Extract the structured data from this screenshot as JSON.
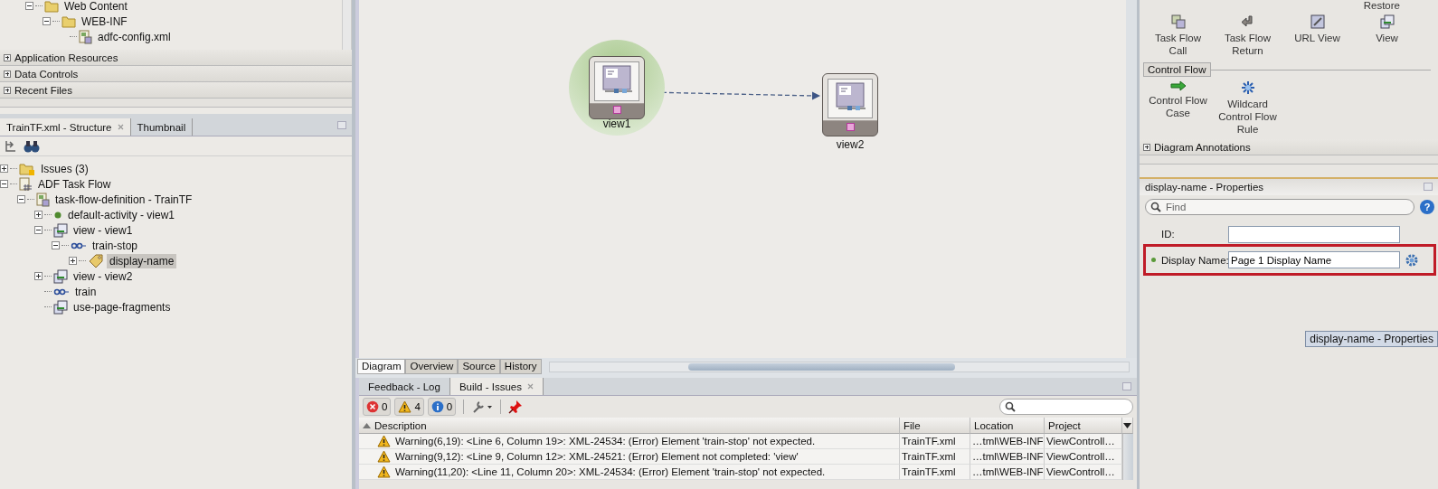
{
  "navigator": {
    "tree": [
      {
        "label": "Web Content",
        "kind": "folder",
        "expanded": true,
        "selected": false,
        "children": [
          {
            "label": "WEB-INF",
            "kind": "folder",
            "expanded": true,
            "selected": false,
            "children": [
              {
                "label": "adfc-config.xml",
                "kind": "file",
                "selected": false
              }
            ]
          }
        ]
      }
    ],
    "accordions": [
      {
        "label": "Application Resources",
        "expanded": false
      },
      {
        "label": "Data Controls",
        "expanded": false
      },
      {
        "label": "Recent Files",
        "expanded": false
      }
    ]
  },
  "structure": {
    "tabs": [
      {
        "label": "TrainTF.xml - Structure",
        "selected": true,
        "closable": true
      },
      {
        "label": "Thumbnail",
        "selected": false,
        "closable": false
      }
    ],
    "tree": [
      {
        "label": "Issues (3)",
        "kind": "issues",
        "expanded": false,
        "selected": false
      },
      {
        "label": "ADF Task Flow",
        "kind": "taskflow",
        "expanded": true,
        "selected": false,
        "children": [
          {
            "label": "task-flow-definition - TrainTF",
            "kind": "file",
            "expanded": true,
            "selected": false,
            "children": [
              {
                "label": "default-activity - view1",
                "kind": "dot",
                "expanded": false,
                "selected": false
              },
              {
                "label": "view - view1",
                "kind": "view",
                "expanded": true,
                "selected": false,
                "children": [
                  {
                    "label": "train-stop",
                    "kind": "train",
                    "expanded": true,
                    "selected": false,
                    "children": [
                      {
                        "label": "display-name",
                        "kind": "tag",
                        "expanded": false,
                        "selected": true
                      }
                    ]
                  }
                ]
              },
              {
                "label": "view - view2",
                "kind": "view",
                "expanded": false,
                "selected": false
              },
              {
                "label": "train",
                "kind": "train",
                "selected": false
              },
              {
                "label": "use-page-fragments",
                "kind": "view",
                "selected": false
              }
            ]
          }
        ]
      }
    ]
  },
  "diagram": {
    "nodes": [
      {
        "label": "view1",
        "default": true
      },
      {
        "label": "view2",
        "default": false
      }
    ],
    "tabs": [
      {
        "label": "Diagram",
        "selected": true
      },
      {
        "label": "Overview",
        "selected": false
      },
      {
        "label": "Source",
        "selected": false
      },
      {
        "label": "History",
        "selected": false
      }
    ]
  },
  "log": {
    "tabs": [
      {
        "label": "Feedback - Log",
        "selected": false,
        "closable": false
      },
      {
        "label": "Build - Issues",
        "selected": true,
        "closable": true
      }
    ],
    "counts": [
      {
        "kind": "error",
        "count": "0"
      },
      {
        "kind": "warning",
        "count": "4"
      },
      {
        "kind": "info",
        "count": "0"
      }
    ],
    "columns": [
      "Description",
      "File",
      "Location",
      "Project"
    ],
    "rows": [
      {
        "kind": "warning",
        "cells": [
          "Warning(6,19): <Line 6, Column 19>: XML-24534: (Error) Element 'train-stop' not expected.",
          "TrainTF.xml",
          "…tml\\WEB-INF",
          "ViewControll…"
        ]
      },
      {
        "kind": "warning",
        "cells": [
          "Warning(9,12): <Line 9, Column 12>: XML-24521: (Error) Element not completed: 'view'",
          "TrainTF.xml",
          "…tml\\WEB-INF",
          "ViewControll…"
        ]
      },
      {
        "kind": "warning",
        "cells": [
          "Warning(11,20): <Line 11, Column 20>: XML-24534: (Error) Element 'train-stop' not expected.",
          "TrainTF.xml",
          "…tml\\WEB-INF",
          "ViewControll…"
        ]
      }
    ]
  },
  "palette": {
    "top_label": "Restore",
    "items": [
      {
        "label": "Task Flow\nCall",
        "kind": "call"
      },
      {
        "label": "Task Flow\nReturn",
        "kind": "return"
      },
      {
        "label": "URL View",
        "kind": "url"
      },
      {
        "label": "View",
        "kind": "view"
      }
    ],
    "section": "Control Flow",
    "flow_items": [
      {
        "label": "Control Flow\nCase",
        "kind": "case"
      },
      {
        "label": "Wildcard\nControl Flow\nRule",
        "kind": "wildcard"
      }
    ],
    "annotations": {
      "label": "Diagram Annotations",
      "expanded": false
    }
  },
  "properties": {
    "title": "display-name - Properties",
    "search": {
      "placeholder": "Find"
    },
    "help": "?",
    "fields": [
      {
        "label": "ID:",
        "highlighted": false,
        "set": false
      },
      {
        "label": "Display Name:",
        "value": "Page 1 Display Name",
        "highlighted": true,
        "set": true
      }
    ],
    "tooltip": "display-name - Properties"
  }
}
